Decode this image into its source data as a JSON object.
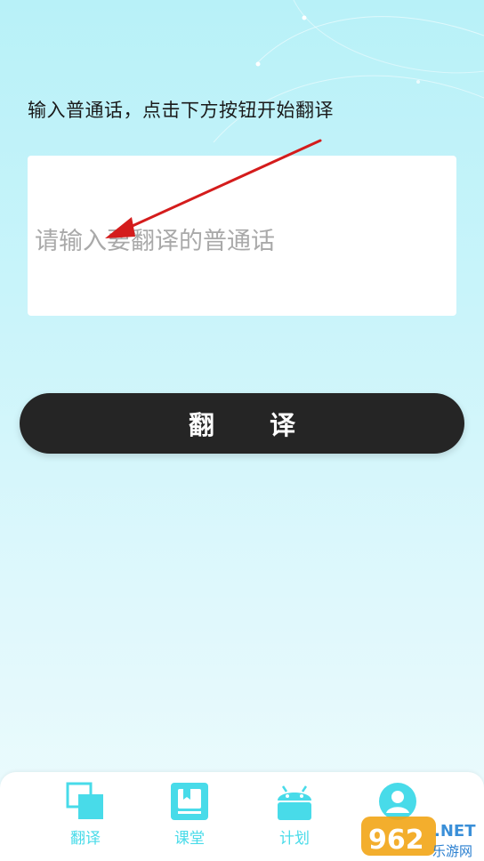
{
  "instruction": "输入普通话，点击下方按钮开始翻译",
  "input": {
    "placeholder": "请输入要翻译的普通话",
    "value": ""
  },
  "translate_button": {
    "label": "翻译"
  },
  "tabs": [
    {
      "label": "翻译",
      "icon": "translate-icon"
    },
    {
      "label": "课堂",
      "icon": "book-icon"
    },
    {
      "label": "计划",
      "icon": "android-icon"
    },
    {
      "label": "",
      "icon": "profile-icon"
    }
  ],
  "watermark": {
    "brand": "962.NET",
    "sub": "乐游网"
  },
  "colors": {
    "accent": "#48dbe9",
    "button": "#252525",
    "arrow": "#d41c1c"
  }
}
